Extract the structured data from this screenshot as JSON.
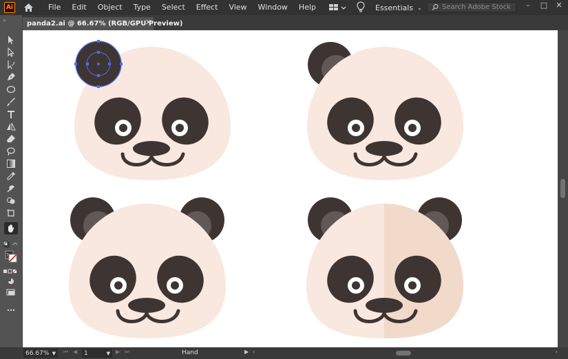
{
  "app": {
    "logo_text": "Ai"
  },
  "menu": [
    "File",
    "Edit",
    "Object",
    "Type",
    "Select",
    "Effect",
    "View",
    "Window",
    "Help"
  ],
  "workspace": {
    "label": "Essentials"
  },
  "search": {
    "placeholder": "Search Adobe Stock"
  },
  "window_controls": {
    "minimize": "–",
    "restore": "□",
    "close": "✕"
  },
  "document": {
    "tab_title": "panda2.ai @ 66.67% (RGB/GPU Preview)",
    "close": "✕"
  },
  "status": {
    "zoom": "66.67%",
    "page": "1",
    "tool": "Hand"
  },
  "colors": {
    "face": "#f9e8df",
    "face_shade": "#f2dacb",
    "dark": "#3e3533",
    "ear_inner": "#625957",
    "selection": "#4a6cf7"
  },
  "tools": [
    "selection-tool",
    "direct-selection-tool",
    "curvature-tool",
    "pen-tool",
    "ellipse-tool",
    "paintbrush-tool",
    "type-tool",
    "reflect-tool",
    "eraser-tool",
    "lasso-tool",
    "gradient-tool",
    "eyedropper-tool",
    "blend-tool",
    "shape-builder-tool",
    "artboard-tool",
    "hand-tool"
  ]
}
